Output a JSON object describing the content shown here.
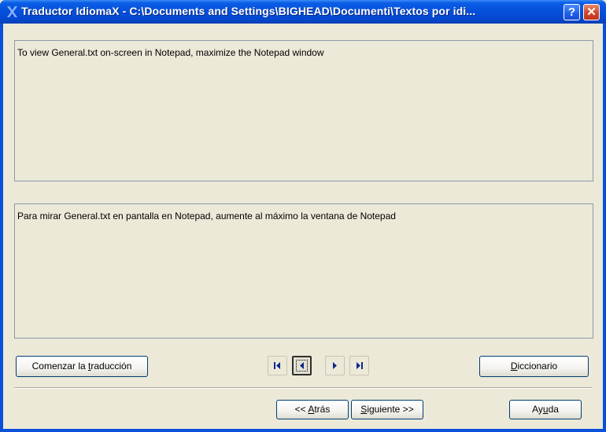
{
  "window": {
    "title": "Traductor IdiomaX - C:\\Documents and Settings\\BIGHEAD\\Documenti\\Textos por idi...",
    "help_label": "?",
    "close_label": "✕"
  },
  "source_text": "To view General.txt on-screen in Notepad, maximize the Notepad window",
  "target_text": "Para mirar General.txt en pantalla en Notepad, aumente al máximo la ventana de Notepad",
  "buttons": {
    "start_prefix": "Comenzar la ",
    "start_mnemonic": "t",
    "start_suffix": "raducción",
    "dict_mnemonic": "D",
    "dict_suffix": "iccionario",
    "back_prefix": "<< ",
    "back_mnemonic": "A",
    "back_suffix": "trás",
    "next_mnemonic": "S",
    "next_suffix": "iguiente >>",
    "help_prefix": "Ay",
    "help_mnemonic": "u",
    "help_suffix": "da"
  },
  "icons": {
    "app": "idiomax-logo-icon",
    "first": "first-record-icon",
    "prev": "previous-record-icon",
    "next": "next-record-icon",
    "last": "last-record-icon"
  },
  "colors": {
    "titlebar": "#0650dc",
    "face": "#ece9d8",
    "close": "#d2452a"
  }
}
